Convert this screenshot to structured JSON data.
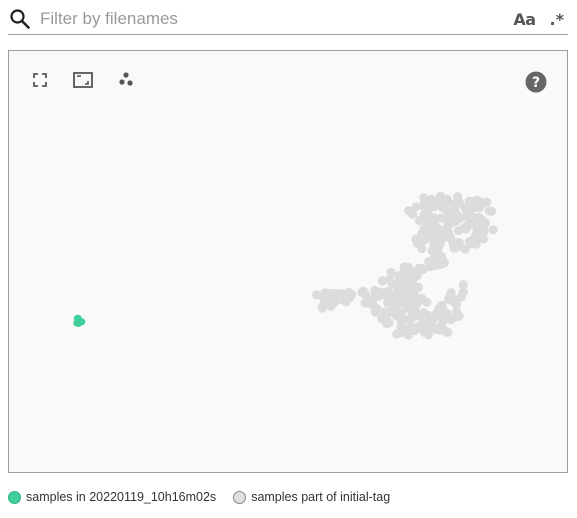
{
  "filter": {
    "placeholder": "Filter by filenames",
    "value": "",
    "case_toggle_label": "Aa",
    "regex_toggle_label": ".*"
  },
  "toolbar": {
    "icons": [
      "fullscreen-icon",
      "zoom-fit-icon",
      "scatter-points-icon"
    ],
    "help_icon": "help-icon"
  },
  "legend": {
    "items": [
      {
        "label": "samples in 20220119_10h16m02s",
        "color": "#3ecf9a"
      },
      {
        "label": "samples part of initial-tag",
        "color": "#e0e0e0"
      }
    ]
  },
  "colors": {
    "highlight": "#3ecf9a",
    "background_points": "#dcdcdc",
    "panel_background": "#f9f9f9"
  }
}
